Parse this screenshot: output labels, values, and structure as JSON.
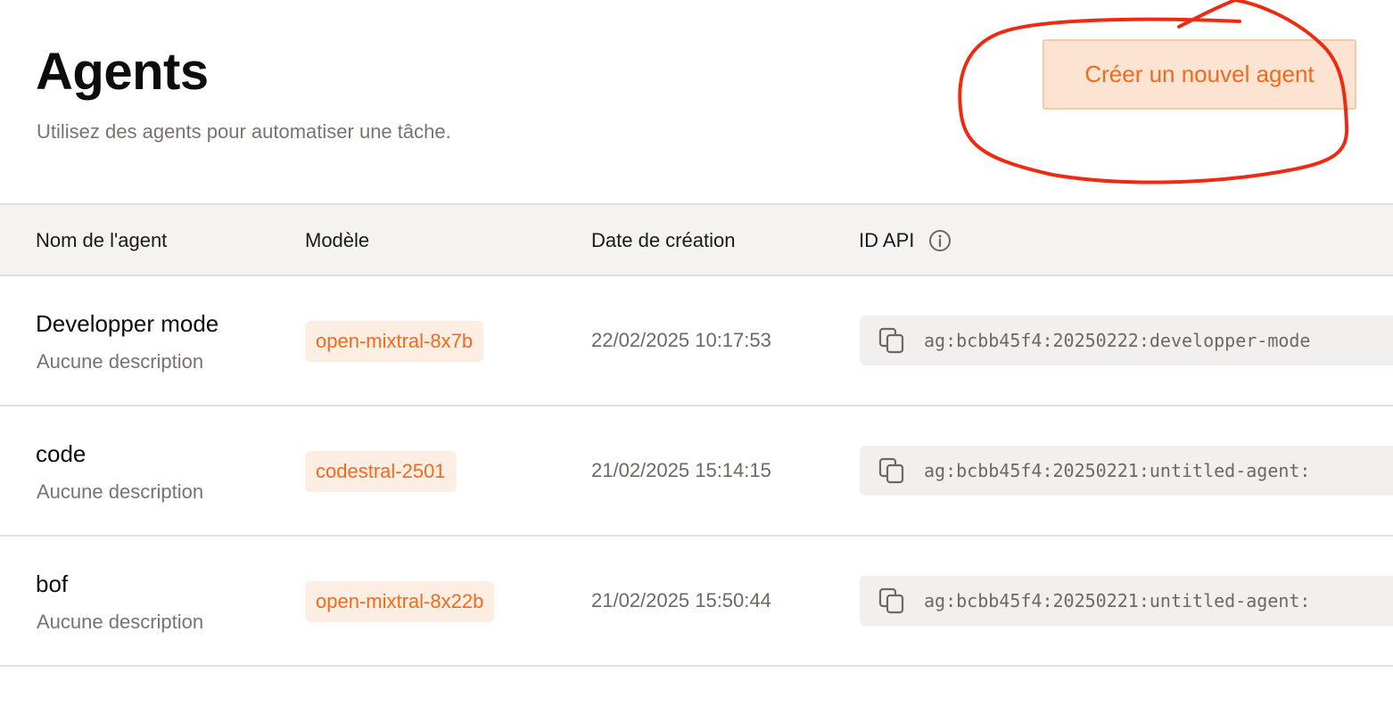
{
  "header": {
    "title": "Agents",
    "subtitle": "Utilisez des agents pour automatiser une tâche.",
    "create_button_label": "Créer un nouvel agent"
  },
  "table": {
    "columns": {
      "name": "Nom de l'agent",
      "model": "Modèle",
      "created": "Date de création",
      "api_id": "ID API"
    },
    "rows": [
      {
        "name": "Developper mode",
        "description": "Aucune description",
        "model": "open-mixtral-8x7b",
        "created": "22/02/2025 10:17:53",
        "api_id": "ag:bcbb45f4:20250222:developper-mode"
      },
      {
        "name": "code",
        "description": "Aucune description",
        "model": "codestral-2501",
        "created": "21/02/2025 15:14:15",
        "api_id": "ag:bcbb45f4:20250221:untitled-agent:"
      },
      {
        "name": "bof",
        "description": "Aucune description",
        "model": "open-mixtral-8x22b",
        "created": "21/02/2025 15:50:44",
        "api_id": "ag:bcbb45f4:20250221:untitled-agent:"
      }
    ]
  },
  "icons": {
    "info": "info-circle-icon",
    "copy": "copy-icon"
  },
  "colors": {
    "accent": "#f26a1b",
    "button_bg": "#fde3d2",
    "badge_bg": "#fdeee3",
    "annotation": "#ee2a10",
    "header_bg": "#f4f3f1",
    "muted_text": "#7a726c"
  }
}
